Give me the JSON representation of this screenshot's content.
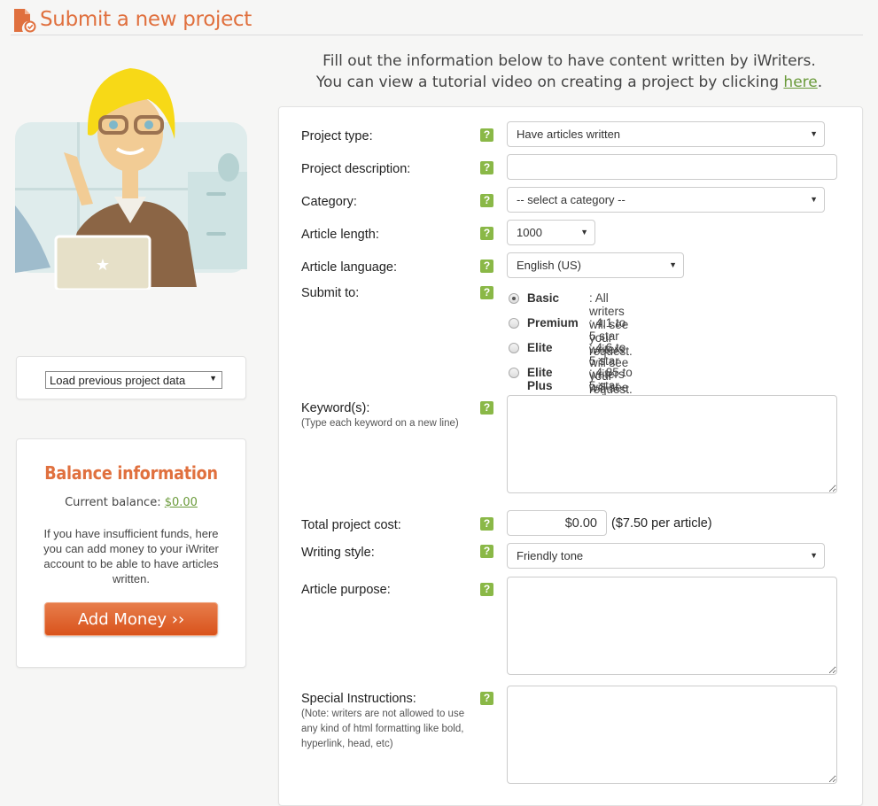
{
  "header": {
    "title": "Submit a new project",
    "icon": "document-check-icon",
    "accent_color": "#e0703e"
  },
  "intro": {
    "line1": "Fill out the information below to have content written by iWriters.",
    "line2_prefix": "You can view a tutorial video on creating a project by clicking ",
    "line2_link": "here",
    "line2_suffix": "."
  },
  "sidebar": {
    "load_select": {
      "value": "Load previous project data"
    },
    "balance": {
      "title": "Balance information",
      "current_label": "Current balance: ",
      "current_value": "$0.00",
      "description": "If you have insufficient funds, here you can add money to your iWriter account to be able to have articles written.",
      "add_money_label": "Add Money ››"
    }
  },
  "form": {
    "help_glyph": "?",
    "project_type": {
      "label": "Project type:",
      "value": "Have articles written"
    },
    "project_description": {
      "label": "Project description:",
      "value": ""
    },
    "category": {
      "label": "Category:",
      "value": "-- select a category --"
    },
    "article_length": {
      "label": "Article length:",
      "value": "1000"
    },
    "article_language": {
      "label": "Article language:",
      "value": "English (US)"
    },
    "submit_to": {
      "label": "Submit to:",
      "selected": "Basic",
      "options": [
        {
          "name": "Basic",
          "desc": ": All writers will see your request."
        },
        {
          "name": "Premium",
          "desc": ": 4.1 to 5 star writers will see your request."
        },
        {
          "name": "Elite",
          "desc": ": 4.6 to 5 star writers will see your request."
        },
        {
          "name": "Elite Plus",
          "desc": ": 4.85 to 5 star writers will see your request."
        }
      ]
    },
    "keywords": {
      "label": "Keyword(s):",
      "hint": "(Type each keyword on a new line)",
      "value": ""
    },
    "total_cost": {
      "label": "Total project cost:",
      "value": "$0.00",
      "per_article": "($7.50 per article)"
    },
    "writing_style": {
      "label": "Writing style:",
      "value": "Friendly tone"
    },
    "article_purpose": {
      "label": "Article purpose:",
      "value": ""
    },
    "special_instructions": {
      "label": "Special Instructions:",
      "hint": "(Note: writers are not allowed to use any kind of html formatting like bold, hyperlink, head, etc)",
      "value": ""
    }
  }
}
